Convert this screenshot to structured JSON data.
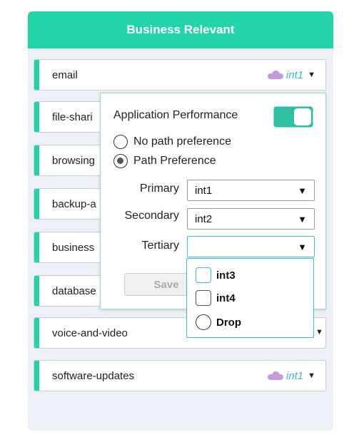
{
  "header": {
    "title": "Business Relevant"
  },
  "rows": [
    {
      "label": "email",
      "link": "int1"
    },
    {
      "label": "file-shari"
    },
    {
      "label": "browsing"
    },
    {
      "label": "backup-a"
    },
    {
      "label": "business"
    },
    {
      "label": "database"
    },
    {
      "label": "voice-and-video"
    },
    {
      "label": "software-updates",
      "link": "int1"
    }
  ],
  "popup": {
    "title": "Application Performance",
    "toggle_on": true,
    "radio_options": [
      "No path preference",
      "Path Preference"
    ],
    "selected_radio": "Path Preference",
    "fields": {
      "primary": {
        "label": "Primary",
        "value": "int1"
      },
      "secondary": {
        "label": "Secondary",
        "value": "int2"
      },
      "tertiary": {
        "label": "Tertiary",
        "value": ""
      }
    },
    "save_label": "Save"
  },
  "tertiary_options": [
    "int3",
    "int4",
    "Drop"
  ],
  "colors": {
    "accent": "#22d5a8",
    "link": "#3eb6e3",
    "cloud": "#c39bdc",
    "focus": "#3ab8e6"
  },
  "icons": {
    "cloud": "cloud-icon",
    "caret": "caret-down-icon",
    "arrow": "triangle-down-icon"
  }
}
